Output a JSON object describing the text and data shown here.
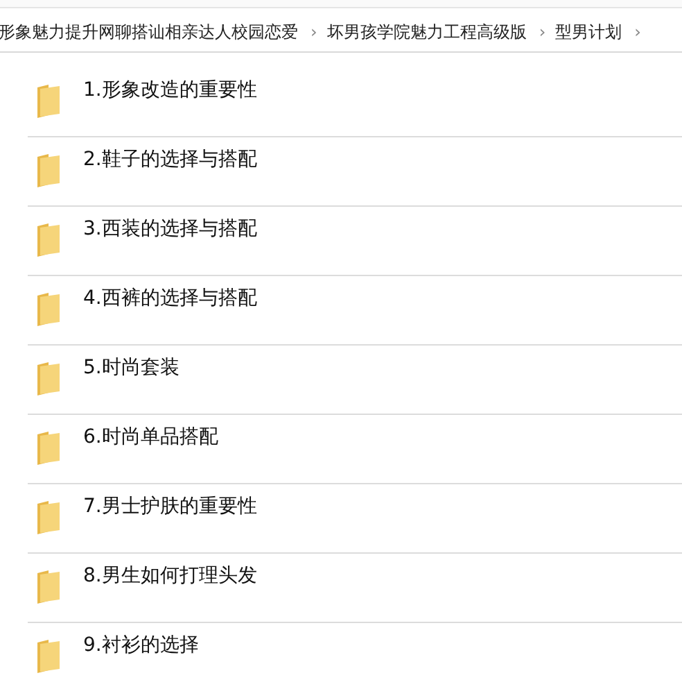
{
  "breadcrumb": [
    {
      "label": "形象魅力提升网聊搭讪相亲达人校园恋爱",
      "separator": "›"
    },
    {
      "label": "坏男孩学院魅力工程高级版",
      "separator": "›"
    },
    {
      "label": "型男计划",
      "separator": "›"
    }
  ],
  "folders": [
    {
      "name": "1.形象改造的重要性"
    },
    {
      "name": "2.鞋子的选择与搭配"
    },
    {
      "name": "3.西装的选择与搭配"
    },
    {
      "name": "4.西裤的选择与搭配"
    },
    {
      "name": "5.时尚套装"
    },
    {
      "name": "6.时尚单品搭配"
    },
    {
      "name": "7.男士护肤的重要性"
    },
    {
      "name": "8.男生如何打理头发"
    },
    {
      "name": "9.衬衫的选择"
    }
  ]
}
